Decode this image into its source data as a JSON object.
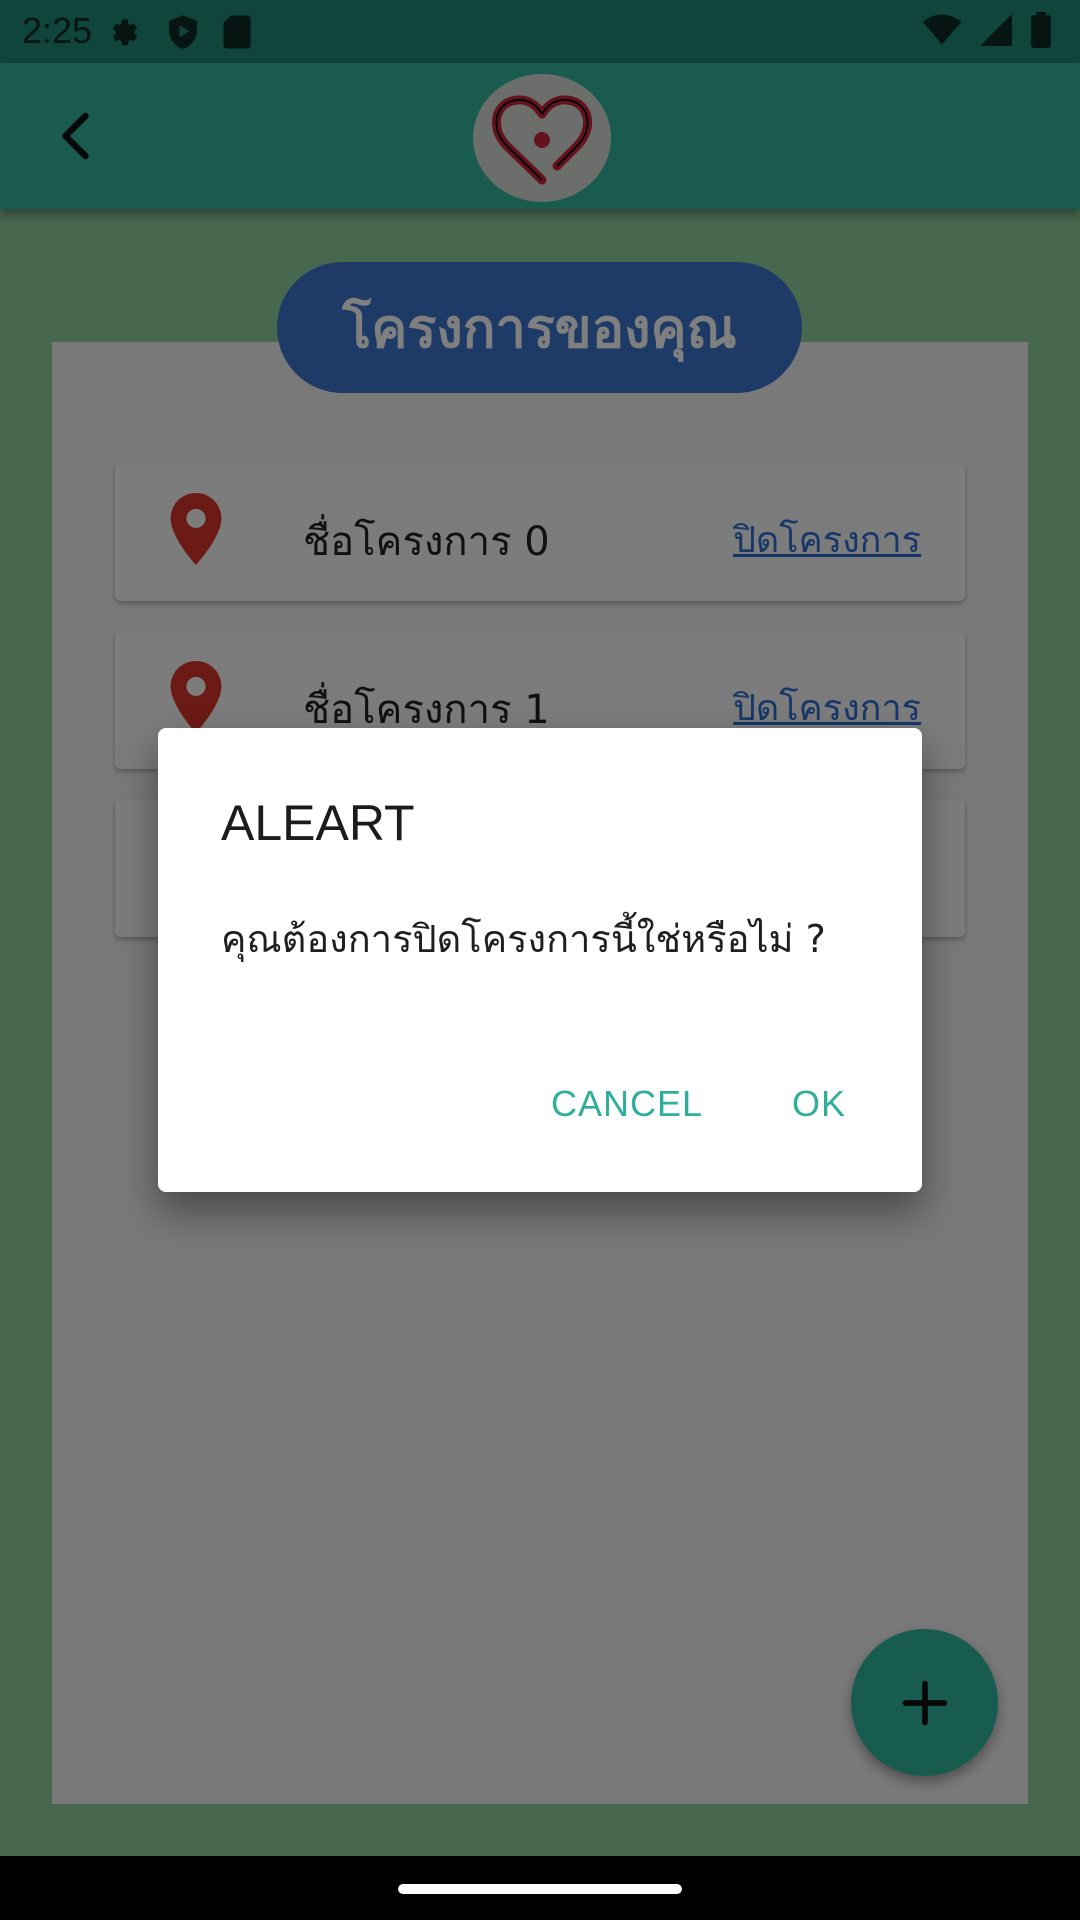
{
  "status_bar": {
    "time": "2:25",
    "icons": [
      "settings-icon",
      "shield-play-icon",
      "sd-card-icon",
      "wifi-icon",
      "signal-icon",
      "battery-icon"
    ]
  },
  "app_bar": {
    "back_icon": "chevron-left-icon",
    "logo": "heart-logo"
  },
  "page": {
    "title": "โครงการของคุณ"
  },
  "projects": [
    {
      "name": "ชื่อโครงการ 0",
      "action": "ปิดโครงการ"
    },
    {
      "name": "ชื่อโครงการ 1",
      "action": "ปิดโครงการ"
    },
    {
      "name": "",
      "action": ""
    }
  ],
  "fab": {
    "icon": "plus-icon"
  },
  "dialog": {
    "title": "ALEART",
    "message": "คุณต้องการปิดโครงการนี้ใช่หรือไม่ ?",
    "cancel_label": "CANCEL",
    "ok_label": "OK"
  },
  "colors": {
    "app_bar": "#34b79e",
    "title_pill": "#3a77cc",
    "pin": "#d9342b",
    "link": "#2c6fd1",
    "dialog_button": "#2fae99",
    "fab": "#31b89e"
  }
}
